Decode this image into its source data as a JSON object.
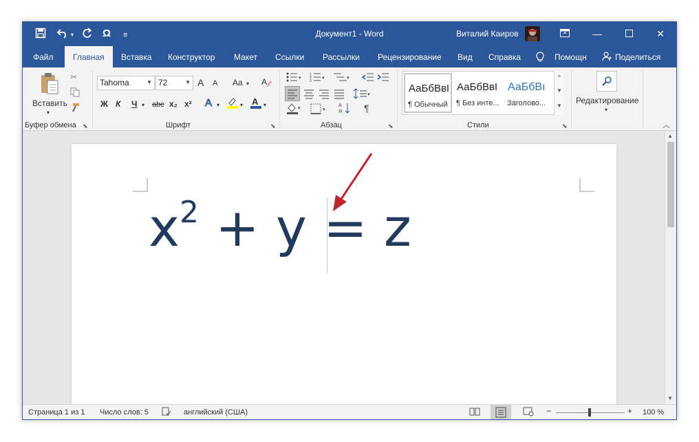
{
  "window": {
    "title": "Документ1 - Word",
    "user_name": "Виталий Каиров",
    "colors": {
      "accent": "#2b579a",
      "equation": "#223a5e",
      "annotation_arrow": "#c0272d"
    }
  },
  "quick_access": {
    "icons": [
      "save-icon",
      "undo-icon",
      "redo-icon",
      "omega-icon",
      "customize-icon"
    ],
    "omega_glyph": "Ω"
  },
  "tabs": [
    {
      "label": "Файл"
    },
    {
      "label": "Главная"
    },
    {
      "label": "Вставка"
    },
    {
      "label": "Конструктор"
    },
    {
      "label": "Макет"
    },
    {
      "label": "Ссылки"
    },
    {
      "label": "Рассылки"
    },
    {
      "label": "Рецензирование"
    },
    {
      "label": "Вид"
    },
    {
      "label": "Справка"
    }
  ],
  "tell_me": "Помощн",
  "share": "Поделиться",
  "ribbon": {
    "clipboard": {
      "label": "Буфер обмена",
      "paste": "Вставить"
    },
    "font": {
      "label": "Шрифт",
      "font_name": "Tahoma",
      "font_size": "72",
      "grow": "A",
      "shrink": "A",
      "change_case": "Aa",
      "bold": "Ж",
      "italic": "К",
      "underline": "Ч",
      "strike": "abc",
      "subscript": "x₂",
      "superscript": "x²"
    },
    "paragraph": {
      "label": "Абзац",
      "pilcrow": "¶"
    },
    "styles": {
      "label": "Стили",
      "items": [
        {
          "sample": "АаБбВвІ",
          "name": "¶ Обычный"
        },
        {
          "sample": "АаБбВвІ",
          "name": "¶ Без инте..."
        },
        {
          "sample": "АаБбВı",
          "name": "Заголово..."
        }
      ]
    },
    "editing": {
      "label": "Редактирование"
    }
  },
  "document": {
    "equation": {
      "base": "x",
      "exponent": "2",
      "rest": " + y = z"
    }
  },
  "status": {
    "page": "Страница 1 из 1",
    "words": "Число слов: 5",
    "language": "английский (США)",
    "zoom": "100 %",
    "zoom_minus": "−",
    "zoom_plus": "+"
  }
}
